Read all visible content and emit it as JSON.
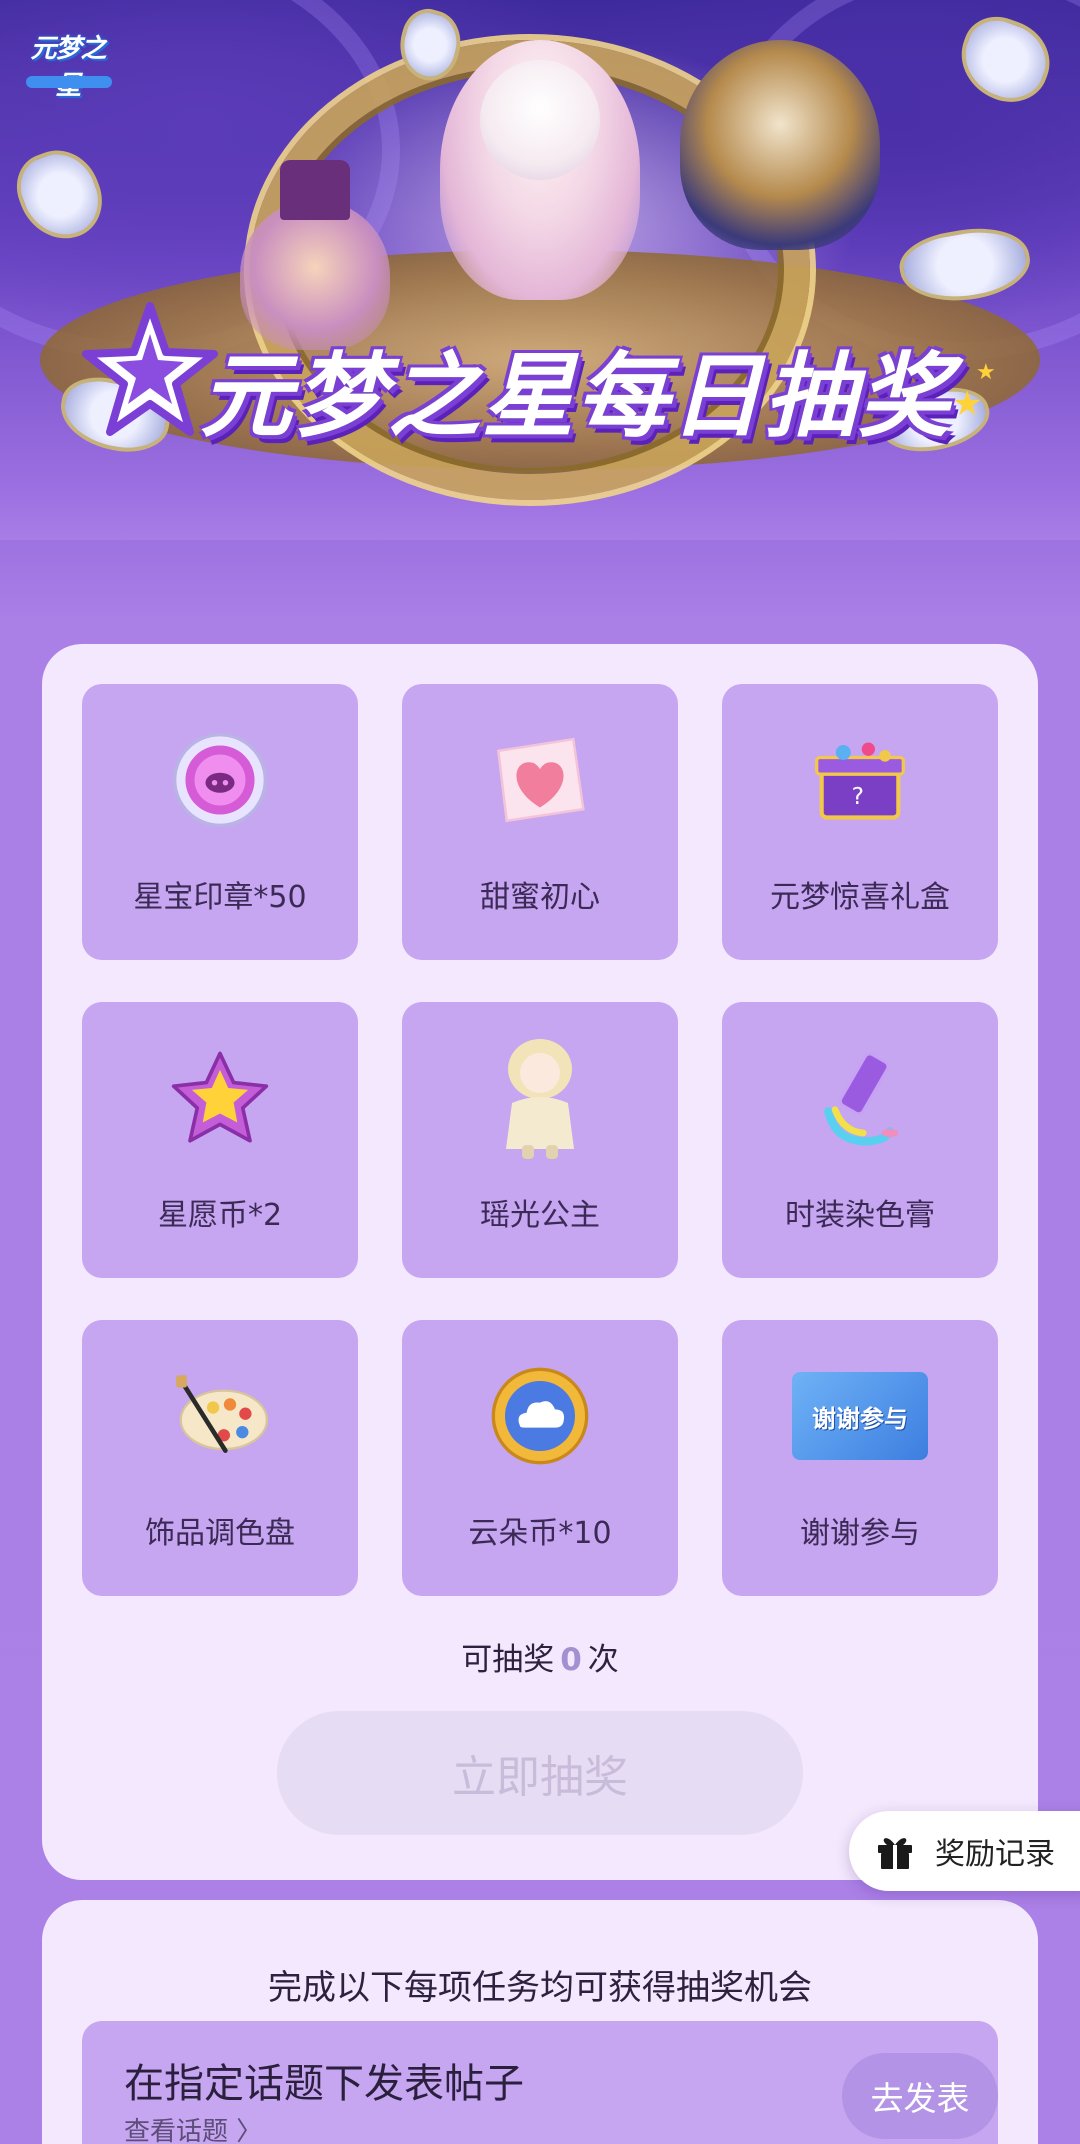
{
  "banner": {
    "logo_text": "元梦之星",
    "title": "元梦之星每日抽奖"
  },
  "prizes": [
    {
      "label": "星宝印章*50",
      "icon": "seal-icon"
    },
    {
      "label": "甜蜜初心",
      "icon": "candy-heart-icon"
    },
    {
      "label": "元梦惊喜礼盒",
      "icon": "gift-box-icon"
    },
    {
      "label": "星愿币*2",
      "icon": "star-coin-icon"
    },
    {
      "label": "瑶光公主",
      "icon": "princess-figure-icon"
    },
    {
      "label": "时装染色膏",
      "icon": "dye-tube-icon"
    },
    {
      "label": "饰品调色盘",
      "icon": "palette-icon"
    },
    {
      "label": "云朵币*10",
      "icon": "cloud-coin-icon"
    },
    {
      "label": "谢谢参与",
      "icon": "thanks-card-icon",
      "card_text": "谢谢参与"
    }
  ],
  "draw": {
    "count_prefix": "可抽奖",
    "count_value": "0",
    "count_suffix": "次",
    "button_label": "立即抽奖"
  },
  "reward_record": {
    "label": "奖励记录"
  },
  "tasks": {
    "heading": "完成以下每项任务均可获得抽奖机会",
    "items": [
      {
        "title": "在指定话题下发表帖子",
        "link": "查看话题 〉",
        "button": "去发表"
      }
    ]
  },
  "colors": {
    "page_bg": "#ab80e7",
    "panel_bg": "#f3e8fd",
    "cell_bg": "#c6a5f1",
    "disabled_button": "#e6dcf3"
  }
}
